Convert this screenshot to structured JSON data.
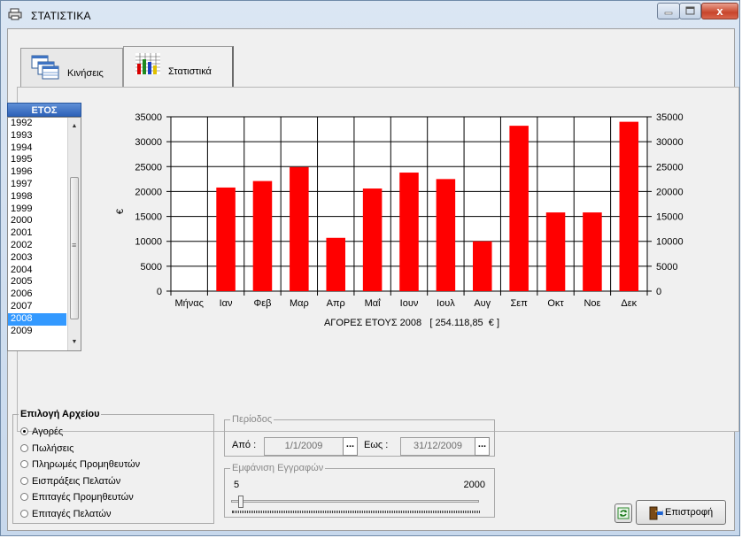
{
  "window": {
    "title": "ΣΤΑΤΙΣΤΙΚΑ",
    "close_glyph": "x"
  },
  "tabs": [
    {
      "label": "Κινήσεις",
      "icon": "table-icon"
    },
    {
      "label": "Στατιστικά",
      "icon": "chart-icon",
      "active": true
    }
  ],
  "years": {
    "header": "ΕΤΟΣ",
    "items": [
      "1992",
      "1993",
      "1994",
      "1995",
      "1996",
      "1997",
      "1998",
      "1999",
      "2000",
      "2001",
      "2002",
      "2003",
      "2004",
      "2005",
      "2006",
      "2007",
      "2008",
      "2009"
    ],
    "selected": "2008"
  },
  "chart_data": {
    "type": "bar",
    "title": "ΑΓΟΡΕΣ ΕΤΟΥΣ 2008   [ 254.118,85  € ]",
    "xlabel": "",
    "ylabel": "€",
    "categories": [
      "Μήνας",
      "Ιαν",
      "Φεβ",
      "Μαρ",
      "Απρ",
      "Μαΐ",
      "Ιουν",
      "Ιουλ",
      "Αυγ",
      "Σεπ",
      "Οκτ",
      "Νοε",
      "Δεκ"
    ],
    "values": [
      0,
      20800,
      22100,
      24900,
      10700,
      20600,
      23800,
      22500,
      10000,
      33200,
      15800,
      15800,
      34000
    ],
    "ylim": [
      0,
      35000
    ],
    "yticks": [
      "0",
      "5000",
      "10000",
      "15000",
      "20000",
      "25000",
      "30000",
      "35000"
    ],
    "bar_color": "#ff0000",
    "grid": true
  },
  "file_select": {
    "title": "Επιλογή Αρχείου",
    "options": [
      "Αγορές",
      "Πωλήσεις",
      "Πληρωμές Προμηθευτών",
      "Εισπράξεις Πελατών",
      "Επιταγές Προμηθευτών",
      "Επιταγές Πελατών"
    ],
    "selected": "Αγορές"
  },
  "period": {
    "title": "Περίοδος",
    "from_label": "Από :",
    "from_value": "1/1/2009",
    "to_label": "Εως :",
    "to_value": "31/12/2009",
    "ellipsis": "..."
  },
  "records": {
    "title": "Εμφάνιση Εγγραφών",
    "min": "5",
    "max": "2000",
    "level": 0.03
  },
  "buttons": {
    "back_label": "Επιστροφή"
  }
}
